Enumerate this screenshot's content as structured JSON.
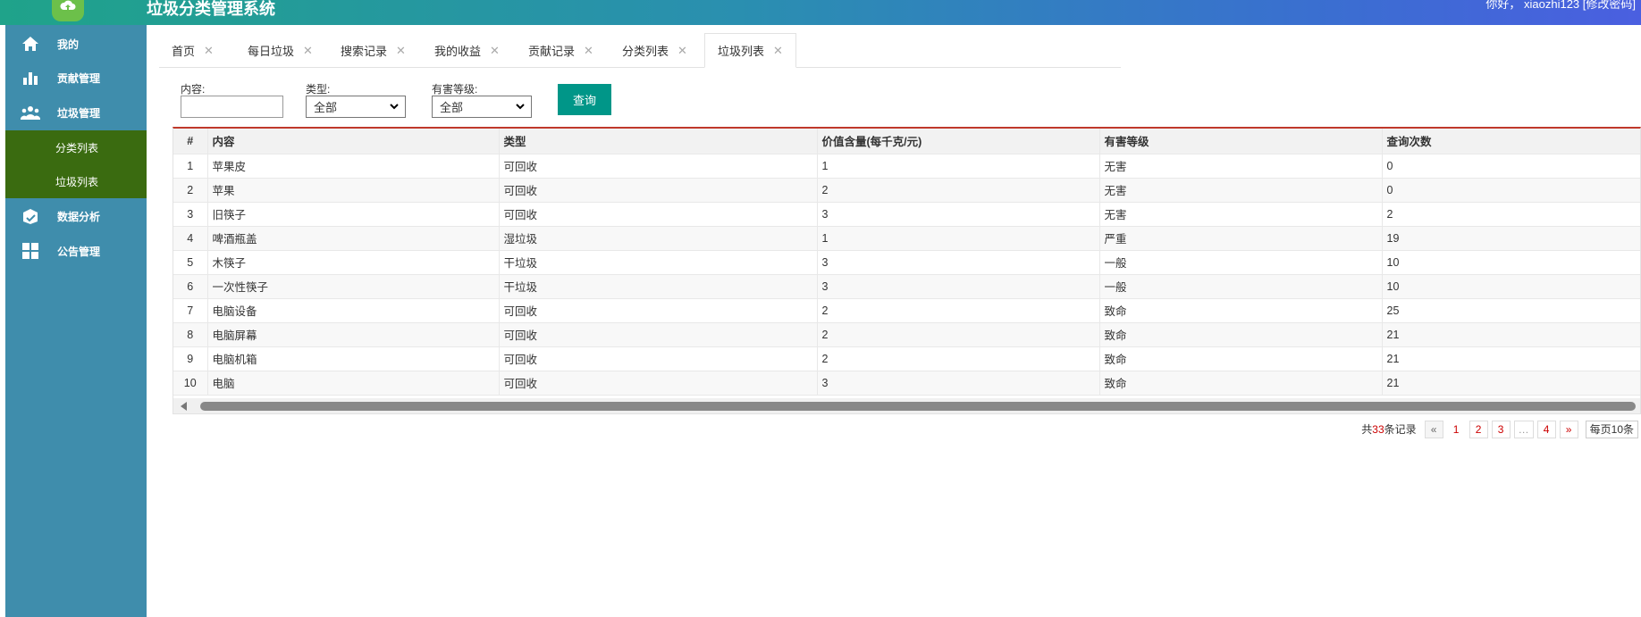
{
  "header": {
    "title": "垃圾分类管理系统",
    "user_text": "你好，   xiaozhi123   [修改密码]"
  },
  "sidebar": {
    "items": [
      {
        "label": "我的",
        "icon": "home-icon"
      },
      {
        "label": "贡献管理",
        "icon": "bar-chart-icon"
      },
      {
        "label": "垃圾管理",
        "icon": "users-icon"
      },
      {
        "label": "数据分析",
        "icon": "analytics-icon"
      },
      {
        "label": "公告管理",
        "icon": "grid-icon"
      }
    ],
    "subitems": [
      {
        "label": "分类列表"
      },
      {
        "label": "垃圾列表"
      }
    ]
  },
  "tabs": [
    {
      "label": "首页"
    },
    {
      "label": "每日垃圾"
    },
    {
      "label": "搜索记录"
    },
    {
      "label": "我的收益"
    },
    {
      "label": "贡献记录"
    },
    {
      "label": "分类列表"
    },
    {
      "label": "垃圾列表",
      "active": true
    }
  ],
  "filters": {
    "content_label": "内容:",
    "content_value": "",
    "type_label": "类型:",
    "type_value": "全部",
    "harm_label": "有害等级:",
    "harm_value": "全部",
    "query_button": "查询"
  },
  "table": {
    "columns": [
      "#",
      "内容",
      "类型",
      "价值含量(每千克/元)",
      "有害等级",
      "查询次数"
    ],
    "rows": [
      [
        "1",
        "苹果皮",
        "可回收",
        "1",
        "无害",
        "0"
      ],
      [
        "2",
        "苹果",
        "可回收",
        "2",
        "无害",
        "0"
      ],
      [
        "3",
        "旧筷子",
        "可回收",
        "3",
        "无害",
        "2"
      ],
      [
        "4",
        "啤酒瓶盖",
        "湿垃圾",
        "1",
        "严重",
        "19"
      ],
      [
        "5",
        "木筷子",
        "干垃圾",
        "3",
        "一般",
        "10"
      ],
      [
        "6",
        "一次性筷子",
        "干垃圾",
        "3",
        "一般",
        "10"
      ],
      [
        "7",
        "电脑设备",
        "可回收",
        "2",
        "致命",
        "25"
      ],
      [
        "8",
        "电脑屏幕",
        "可回收",
        "2",
        "致命",
        "21"
      ],
      [
        "9",
        "电脑机箱",
        "可回收",
        "2",
        "致命",
        "21"
      ],
      [
        "10",
        "电脑",
        "可回收",
        "3",
        "致命",
        "21"
      ]
    ]
  },
  "pagination": {
    "total_prefix": "共",
    "total_count": "33",
    "total_suffix": "条记录",
    "prev": "«",
    "pages": [
      "1",
      "2",
      "3",
      "…",
      "4"
    ],
    "next": "»",
    "page_size": "每页10条"
  },
  "colors": {
    "sidebar": "#3f8dac",
    "subnav": "#3a6b10",
    "accent": "#009688",
    "table_top": "#c0392b"
  }
}
